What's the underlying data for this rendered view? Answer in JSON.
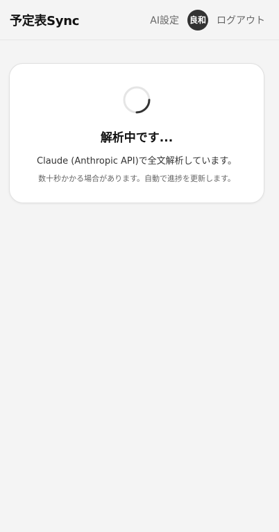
{
  "header": {
    "title": "予定表Sync",
    "ai_settings_label": "AI設定",
    "avatar_text": "良和",
    "logout_label": "ログアウト"
  },
  "status_card": {
    "title": "解析中です...",
    "description": "Claude (Anthropic API)で全文解析しています。",
    "note": "数十秒かかる場合があります。自動で進捗を更新します。",
    "spinner_icon": "loading-spinner-icon"
  },
  "colors": {
    "background": "#f4f4f4",
    "card": "#ffffff",
    "avatar_bg": "#333333",
    "spinner_track": "#e5e5e5",
    "spinner_arc": "#333333"
  }
}
